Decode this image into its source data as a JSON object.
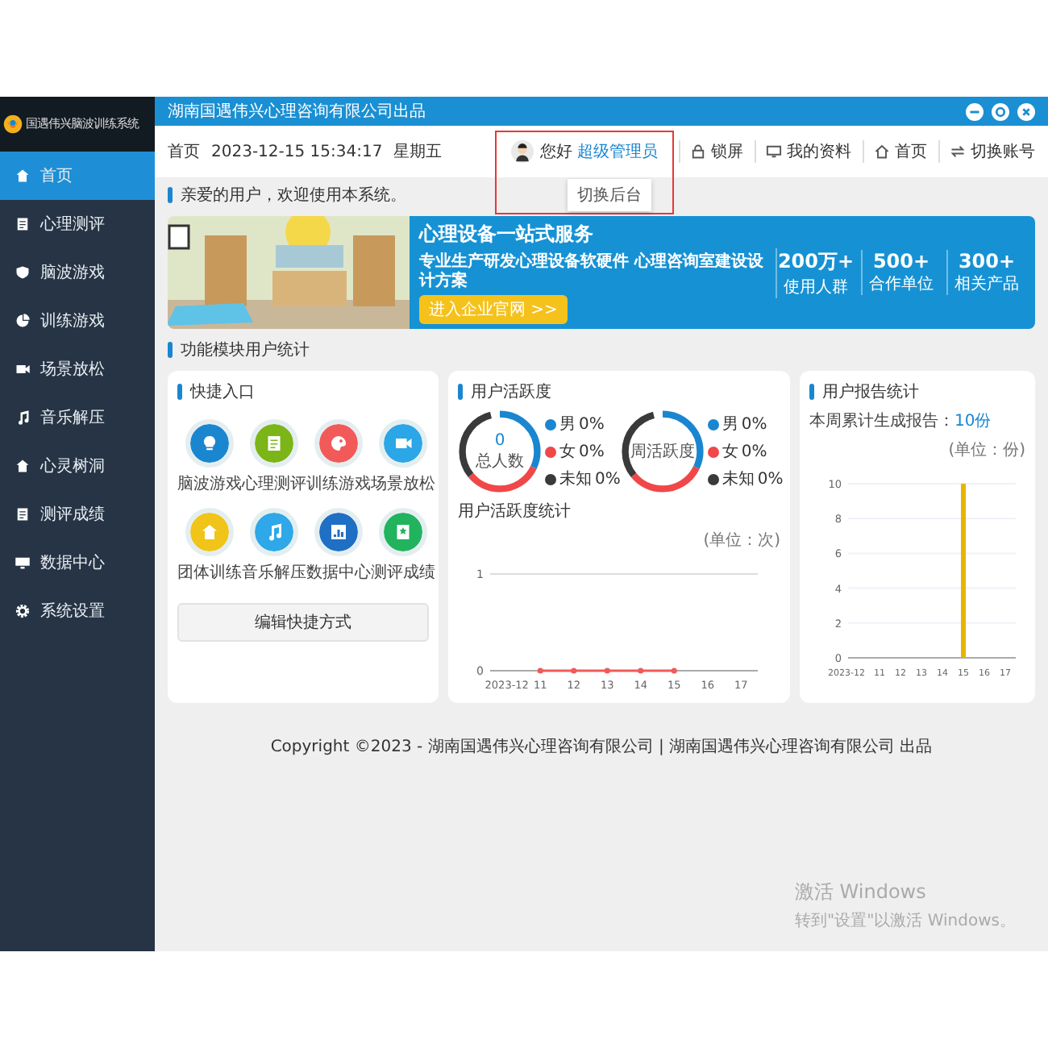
{
  "app": {
    "logo_title": "国遇伟兴脑波训练系统"
  },
  "sidebar": {
    "items": [
      {
        "label": "首页",
        "selected": true
      },
      {
        "label": "心理测评",
        "selected": false
      },
      {
        "label": "脑波游戏",
        "selected": false
      },
      {
        "label": "训练游戏",
        "selected": false
      },
      {
        "label": "场景放松",
        "selected": false
      },
      {
        "label": "音乐解压",
        "selected": false
      },
      {
        "label": "心灵树洞",
        "selected": false
      },
      {
        "label": "测评成绩",
        "selected": false
      },
      {
        "label": "数据中心",
        "selected": false
      },
      {
        "label": "系统设置",
        "selected": false
      }
    ]
  },
  "top_bar": {
    "text": "湖南国遇伟兴心理咨询有限公司出品"
  },
  "header": {
    "breadcrumb": "首页",
    "datetime": "2023-12-15 15:34:17",
    "weekday": "星期五",
    "user": {
      "greeting": "您好",
      "name": "超级管理员",
      "highlighted": true,
      "dropdown": "切换后台"
    },
    "links": [
      "锁屏",
      "我的资料",
      "首页",
      "切换账号"
    ]
  },
  "greeting": "亲爱的用户，欢迎使用本系统。",
  "banner": {
    "title": "心理设备一站式服务",
    "subtitle": "专业生产研发心理设备软硬件 心理咨询室建设设计方案",
    "button": "进入企业官网 >>",
    "stats": [
      {
        "value": "200万+",
        "label": "使用人群"
      },
      {
        "value": "500+",
        "label": "合作单位"
      },
      {
        "value": "300+",
        "label": "相关产品"
      }
    ]
  },
  "section_title": "功能模块用户统计",
  "quick_entry": {
    "title": "快捷入口",
    "items": [
      {
        "label": "脑波游戏",
        "color": "#1a86d0"
      },
      {
        "label": "心理测评",
        "color": "#7cb518"
      },
      {
        "label": "训练游戏",
        "color": "#f25a5a"
      },
      {
        "label": "场景放松",
        "color": "#2ba6e6"
      },
      {
        "label": "团体训练",
        "color": "#f0c419"
      },
      {
        "label": "音乐解压",
        "color": "#2ea8e8"
      },
      {
        "label": "数据中心",
        "color": "#1f6fc4"
      },
      {
        "label": "测评成绩",
        "color": "#22b35e"
      }
    ],
    "edit_button": "编辑快捷方式"
  },
  "activity": {
    "title": "用户活跃度",
    "donuts": [
      {
        "center_value": "0",
        "center_label": "总人数",
        "legend": [
          {
            "label": "男",
            "value": "0%",
            "color": "#1a86d0"
          },
          {
            "label": "女",
            "value": "0%",
            "color": "#f04848"
          },
          {
            "label": "未知",
            "value": "0%",
            "color": "#3a3a3a"
          }
        ]
      },
      {
        "center_label": "周活跃度",
        "legend": [
          {
            "label": "男",
            "value": "0%",
            "color": "#1a86d0"
          },
          {
            "label": "女",
            "value": "0%",
            "color": "#f04848"
          },
          {
            "label": "未知",
            "value": "0%",
            "color": "#3a3a3a"
          }
        ]
      }
    ],
    "trend": {
      "title": "用户活跃度统计",
      "unit": "(单位：次)",
      "chart_data": {
        "type": "line",
        "categories": [
          "2023-12",
          "11",
          "12",
          "13",
          "14",
          "15",
          "16",
          "17"
        ],
        "series": [
          {
            "color": "#f05a5a",
            "marker": true,
            "values": [
              null,
              0,
              0,
              0,
              0,
              0,
              null,
              null
            ]
          }
        ],
        "ylim": [
          0,
          1
        ],
        "yticks": [
          0,
          1
        ]
      }
    }
  },
  "reports": {
    "title": "用户报告统计",
    "summary_label": "本周累计生成报告：",
    "summary_value": "10份",
    "unit": "(单位：份)",
    "chart_data": {
      "type": "bar",
      "categories": [
        "2023-12",
        "11",
        "12",
        "13",
        "14",
        "15",
        "16",
        "17"
      ],
      "series": [
        {
          "color": "#e8b400",
          "values": [
            0,
            0,
            0,
            0,
            0,
            10,
            0,
            0
          ]
        }
      ],
      "ylim": [
        0,
        10
      ],
      "yticks": [
        0,
        2,
        4,
        6,
        8,
        10
      ],
      "grid": true
    }
  },
  "footer": "Copyright ©2023 - 湖南国遇伟兴心理咨询有限公司 | 湖南国遇伟兴心理咨询有限公司 出品",
  "watermark": {
    "title": "激活 Windows",
    "subtitle": "转到\"设置\"以激活 Windows。"
  }
}
